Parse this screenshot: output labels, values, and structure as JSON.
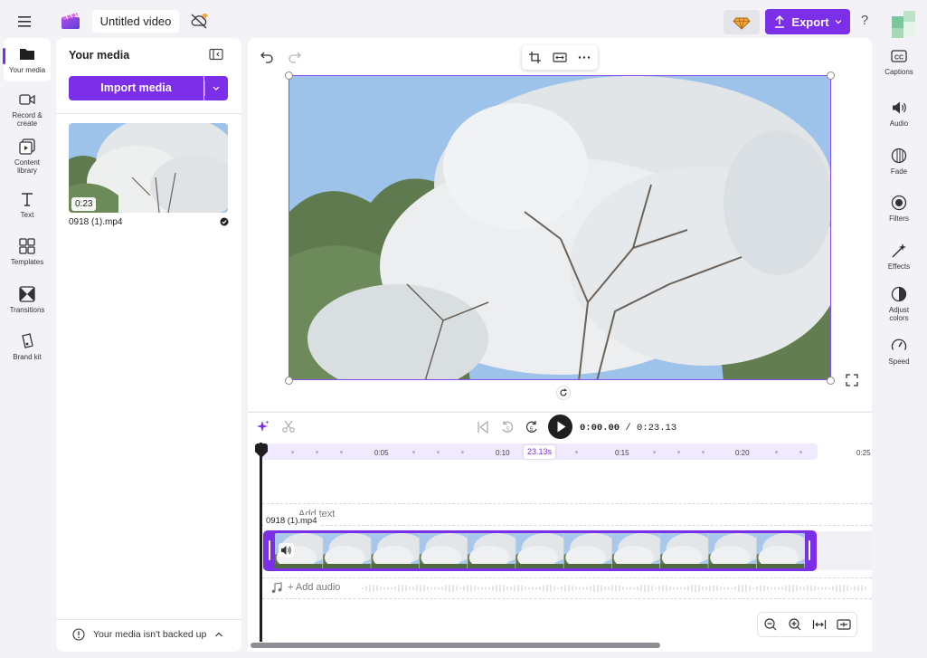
{
  "header": {
    "menu_icon": "hamburger-icon",
    "project_title": "Untitled video",
    "export_label": "Export",
    "help_label": "?"
  },
  "left_rail": {
    "items": [
      {
        "label": "Your media",
        "icon": "folder-icon",
        "selected": true
      },
      {
        "label": "Record &",
        "label2": "create",
        "icon": "camera-icon"
      },
      {
        "label": "Content",
        "label2": "library",
        "icon": "library-icon"
      },
      {
        "label": "Text",
        "icon": "text-icon"
      },
      {
        "label": "Templates",
        "icon": "templates-icon"
      },
      {
        "label": "Transitions",
        "icon": "transitions-icon"
      },
      {
        "label": "Brand kit",
        "icon": "brand-kit-icon"
      }
    ]
  },
  "media_panel": {
    "title": "Your media",
    "import_label": "Import media",
    "items": [
      {
        "duration": "0:23",
        "name": "0918 (1).mp4",
        "status": "added"
      }
    ],
    "backup_notice": "Your media isn't backed up"
  },
  "right_rail": {
    "items": [
      {
        "label": "Captions",
        "icon": "captions-icon"
      },
      {
        "label": "Audio",
        "icon": "audio-icon"
      },
      {
        "label": "Fade",
        "icon": "fade-icon"
      },
      {
        "label": "Filters",
        "icon": "filters-icon"
      },
      {
        "label": "Effects",
        "icon": "effects-icon"
      },
      {
        "label": "Adjust",
        "label2": "colors",
        "icon": "adjust-colors-icon"
      },
      {
        "label": "Speed",
        "icon": "speed-icon"
      }
    ]
  },
  "playback": {
    "current_time": "0:00.00",
    "separator": " / ",
    "total_time": "0:23.13"
  },
  "timeline": {
    "ticks": [
      "0:05",
      "0:10",
      "0:15",
      "0:20",
      "0:25"
    ],
    "duration_tip": "23.13s",
    "text_track_label": "Add text",
    "clip_name": "0918 (1).mp4",
    "audio_track_label": "+ Add audio"
  },
  "colors": {
    "accent": "#7b2fe9",
    "sky": "#9ec3ea",
    "foliage": "#5f7a4f",
    "blossom": "#eef0f0"
  }
}
